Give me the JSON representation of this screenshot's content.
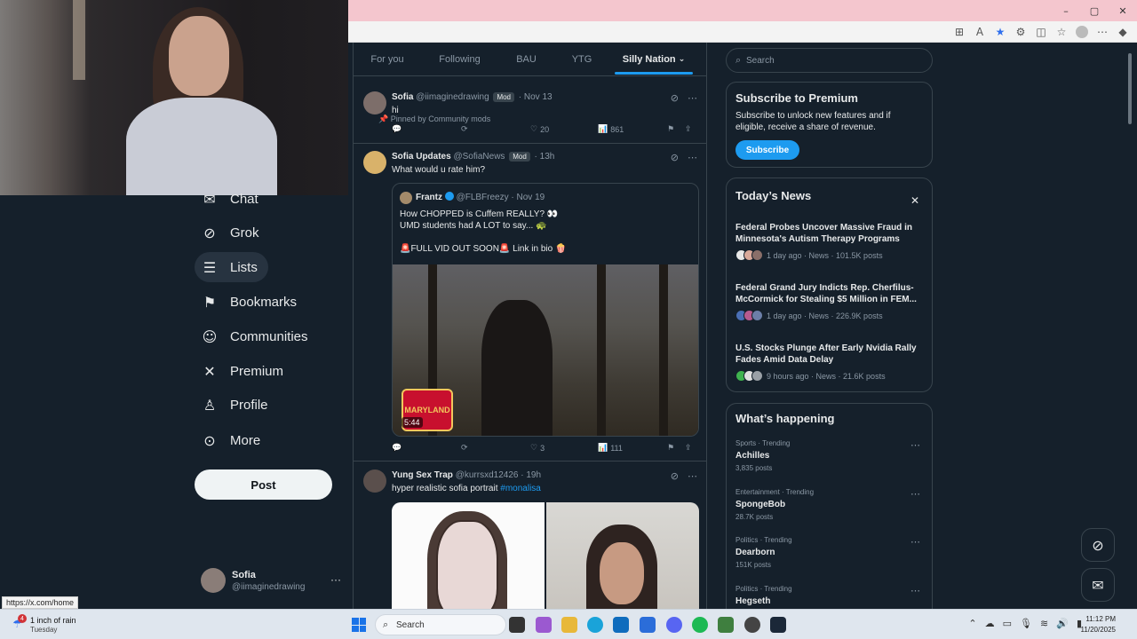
{
  "browser": {
    "window_controls": [
      "–",
      "▢",
      "✕"
    ],
    "status_url": "https://x.com/home"
  },
  "sidebar": {
    "items": [
      {
        "label": "Chat",
        "icon": "chat-icon"
      },
      {
        "label": "Grok",
        "icon": "grok-icon"
      },
      {
        "label": "Lists",
        "icon": "lists-icon",
        "active": true
      },
      {
        "label": "Bookmarks",
        "icon": "bookmark-icon"
      },
      {
        "label": "Communities",
        "icon": "communities-icon"
      },
      {
        "label": "Premium",
        "icon": "x-logo-icon"
      },
      {
        "label": "Profile",
        "icon": "person-icon"
      },
      {
        "label": "More",
        "icon": "more-circle-icon"
      }
    ],
    "post_label": "Post",
    "account": {
      "name": "Sofia",
      "handle": "@iimaginedrawing",
      "more": "···"
    }
  },
  "main": {
    "tabs": [
      {
        "label": "For you"
      },
      {
        "label": "Following"
      },
      {
        "label": "BAU"
      },
      {
        "label": "YTG"
      },
      {
        "label": "Silly Nation",
        "active": true
      }
    ],
    "tweets": [
      {
        "pinned": "Pinned by Community mods",
        "name": "Sofia",
        "handle": "@iimaginedrawing",
        "badge": "Mod",
        "time": "· Nov 13",
        "text": "hi",
        "likes": "20",
        "views": "861"
      },
      {
        "name": "Sofia Updates",
        "handle": "@SofiaNews",
        "badge": "Mod",
        "time": "· 13h",
        "text": "What would u rate him?",
        "quote": {
          "name": "Frantz",
          "handle": "@FLBFreezy",
          "time": "· Nov 19",
          "line1": "How CHOPPED is Cuffem REALLY? 👀",
          "line2": "UMD students had A LOT to say... 🐢",
          "line3": "🚨FULL VID OUT SOON🚨 Link in bio 🍿",
          "logo_text": "MARYLAND",
          "duration": "5:44"
        },
        "likes": "3",
        "views": "111"
      },
      {
        "name": "Yung Sex Trap",
        "handle": "@kurrsxd12426",
        "time": "· 19h",
        "text": "hyper realistic sofia portrait",
        "hashtag": "#monalisa"
      }
    ]
  },
  "right": {
    "search_placeholder": "Search",
    "premium": {
      "title": "Subscribe to Premium",
      "text": "Subscribe to unlock new features and if eligible, receive a share of revenue.",
      "button": "Subscribe"
    },
    "news": {
      "title": "Today’s News",
      "items": [
        {
          "title1": "Federal Probes Uncover Massive Fraud in",
          "title2": "Minnesota's Autism Therapy Programs",
          "meta": "1 day ago · News · 101.5K posts"
        },
        {
          "title1": "Federal Grand Jury Indicts Rep. Cherfilus-",
          "title2": "McCormick for Stealing $5 Million in FEM...",
          "meta": "1 day ago · News · 226.9K posts"
        },
        {
          "title1": "U.S. Stocks Plunge After Early Nvidia Rally",
          "title2": "Fades Amid Data Delay",
          "meta": "9 hours ago · News · 21.6K posts"
        }
      ]
    },
    "happening": {
      "title": "What’s happening",
      "trends": [
        {
          "category": "Sports · Trending",
          "name": "Achilles",
          "posts": "3,835 posts"
        },
        {
          "category": "Entertainment · Trending",
          "name": "SpongeBob",
          "posts": "28.7K posts"
        },
        {
          "category": "Politics · Trending",
          "name": "Dearborn",
          "posts": "151K posts"
        },
        {
          "category": "Politics · Trending",
          "name": "Hegseth",
          "posts": ""
        }
      ]
    }
  },
  "taskbar": {
    "weather_badge": "4",
    "weather_line1": "1 inch of rain",
    "weather_line2": "Tuesday",
    "search": "Search",
    "time": "11:12 PM",
    "date": "11/20/2025"
  },
  "colors": {
    "accent": "#1d9bf0",
    "background": "#15202b",
    "border": "#38444d"
  }
}
